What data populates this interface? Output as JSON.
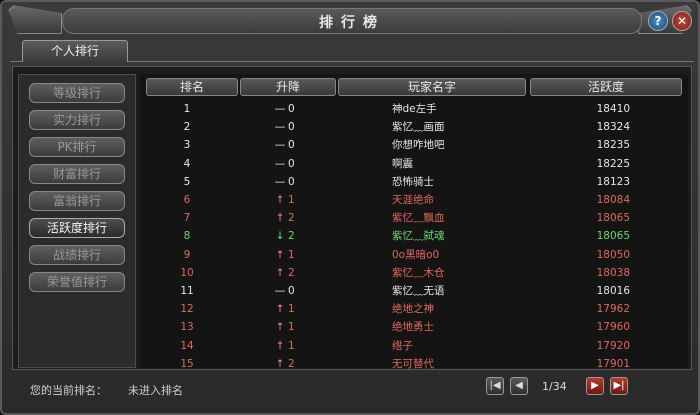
{
  "window": {
    "title": "排行榜"
  },
  "tabs": [
    {
      "label": "个人排行"
    }
  ],
  "side_menu": [
    {
      "label": "等级排行",
      "active": false
    },
    {
      "label": "实力排行",
      "active": false
    },
    {
      "label": "PK排行",
      "active": false
    },
    {
      "label": "财富排行",
      "active": false
    },
    {
      "label": "富翁排行",
      "active": false
    },
    {
      "label": "活跃度排行",
      "active": true
    },
    {
      "label": "战绩排行",
      "active": false
    },
    {
      "label": "荣誉值排行",
      "active": false
    }
  ],
  "table": {
    "headers": [
      "排名",
      "升降",
      "玩家名字",
      "活跃度"
    ],
    "rows": [
      {
        "rank": "1",
        "arrow": "—",
        "delta": "0",
        "name": "神de左手",
        "activity": "18410",
        "color": "#e6e6e6",
        "arrow_color": "#e6e6e6"
      },
      {
        "rank": "2",
        "arrow": "—",
        "delta": "0",
        "name": "紫忆﹏画面",
        "activity": "18324",
        "color": "#e6e6e6",
        "arrow_color": "#e6e6e6"
      },
      {
        "rank": "3",
        "arrow": "—",
        "delta": "0",
        "name": "你想咋地吧",
        "activity": "18235",
        "color": "#e6e6e6",
        "arrow_color": "#e6e6e6"
      },
      {
        "rank": "4",
        "arrow": "—",
        "delta": "0",
        "name": "啊震",
        "activity": "18225",
        "color": "#e6e6e6",
        "arrow_color": "#e6e6e6"
      },
      {
        "rank": "5",
        "arrow": "—",
        "delta": "0",
        "name": "恐怖骑士",
        "activity": "18123",
        "color": "#e6e6e6",
        "arrow_color": "#e6e6e6"
      },
      {
        "rank": "6",
        "arrow": "↑",
        "delta": "1",
        "name": "天涯绝命",
        "activity": "18084",
        "color": "#e0685e",
        "arrow_color": "#f08a80"
      },
      {
        "rank": "7",
        "arrow": "↑",
        "delta": "2",
        "name": "紫忆﹏飘血",
        "activity": "18065",
        "color": "#e0685e",
        "arrow_color": "#f08a80"
      },
      {
        "rank": "8",
        "arrow": "↓",
        "delta": "2",
        "name": "紫忆﹏弑魂",
        "activity": "18065",
        "color": "#6bd86b",
        "arrow_color": "#7ae07a"
      },
      {
        "rank": "9",
        "arrow": "↑",
        "delta": "1",
        "name": "0o黑暗o0",
        "activity": "18050",
        "color": "#e0685e",
        "arrow_color": "#f08a80"
      },
      {
        "rank": "10",
        "arrow": "↑",
        "delta": "2",
        "name": "紫忆﹏木仓",
        "activity": "18038",
        "color": "#e0685e",
        "arrow_color": "#f08a80"
      },
      {
        "rank": "11",
        "arrow": "—",
        "delta": "0",
        "name": "紫忆﹏无语",
        "activity": "18016",
        "color": "#e6e6e6",
        "arrow_color": "#e6e6e6"
      },
      {
        "rank": "12",
        "arrow": "↑",
        "delta": "1",
        "name": "绝地之神",
        "activity": "17962",
        "color": "#e0685e",
        "arrow_color": "#f08a80"
      },
      {
        "rank": "13",
        "arrow": "↑",
        "delta": "1",
        "name": "绝地勇士",
        "activity": "17960",
        "color": "#e0685e",
        "arrow_color": "#f08a80"
      },
      {
        "rank": "14",
        "arrow": "↑",
        "delta": "1",
        "name": "绺子",
        "activity": "17920",
        "color": "#e0685e",
        "arrow_color": "#f08a80"
      },
      {
        "rank": "15",
        "arrow": "↑",
        "delta": "2",
        "name": "无可替代",
        "activity": "17901",
        "color": "#e0685e",
        "arrow_color": "#f08a80"
      }
    ]
  },
  "footer": {
    "my_rank_label": "您的当前排名：",
    "my_rank_value": "未进入排名",
    "page_indicator": "1/34"
  }
}
